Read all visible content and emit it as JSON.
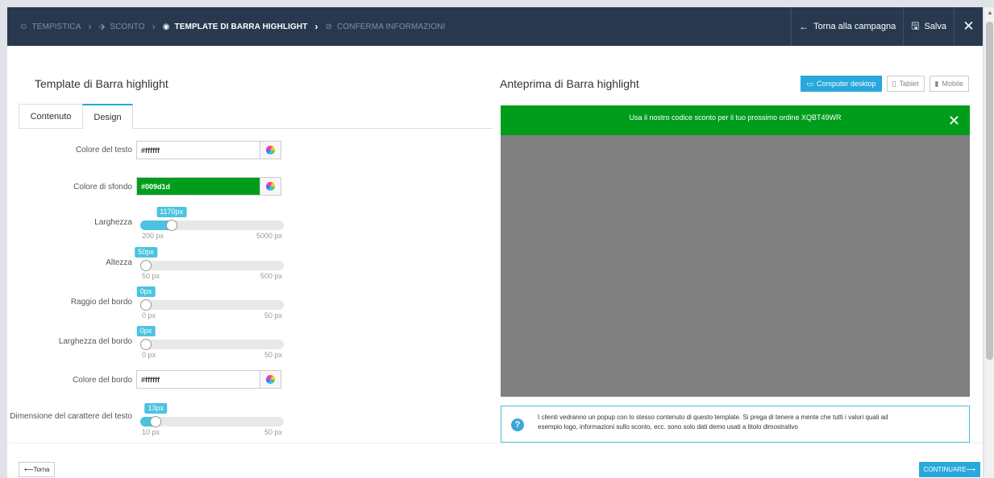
{
  "breadcrumb": [
    {
      "label": "TEMPISTICA",
      "icon": "clock-icon",
      "active": false
    },
    {
      "label": "SCONTO",
      "icon": "tag-icon",
      "active": false
    },
    {
      "label": "TEMPLATE DI BARRA HIGHLIGHT",
      "icon": "eye-icon",
      "active": true
    },
    {
      "label": "CONFERMA INFORMAZIONI",
      "icon": "check-circle-icon",
      "active": false
    }
  ],
  "topbar": {
    "back_label": "Torna alla campagna",
    "save_label": "Salva",
    "close_label": "✕"
  },
  "left": {
    "title": "Template di Barra highlight",
    "tabs": [
      "Contenuto",
      "Design"
    ],
    "active_tab": "Design",
    "fields": {
      "text_color": {
        "label": "Colore del testo",
        "value": "#ffffff"
      },
      "bg_color": {
        "label": "Colore di sfondo",
        "value": "#009d1d"
      },
      "width": {
        "label": "Larghezza",
        "value": "1170px",
        "min": "200 px",
        "max": "5000 px",
        "fraction": 0.193
      },
      "height": {
        "label": "Altezza",
        "value": "50px",
        "min": "50 px",
        "max": "500 px",
        "fraction": 0.0
      },
      "radius": {
        "label": "Raggio del bordo",
        "value": "0px",
        "min": "0 px",
        "max": "50 px",
        "fraction": 0.0
      },
      "border_width": {
        "label": "Larghezza del bordo",
        "value": "0px",
        "min": "0 px",
        "max": "50 px",
        "fraction": 0.0
      },
      "border_color": {
        "label": "Colore del bordo",
        "value": "#ffffff"
      },
      "font_size": {
        "label": "Dimensione del carattere del testo",
        "value": "13px",
        "min": "10 px",
        "max": "50 px",
        "fraction": 0.075
      }
    }
  },
  "right": {
    "title": "Anteprima di Barra highlight",
    "devices": [
      {
        "label": "Computer desktop",
        "icon": "desktop-icon",
        "active": true
      },
      {
        "label": "Tablet",
        "icon": "tablet-icon",
        "active": false
      },
      {
        "label": "Mobile",
        "icon": "mobile-icon",
        "active": false
      }
    ],
    "bar_text": "Usa il nostro codice sconto per il tuo prossimo ordine XQBT49WR",
    "bar_color": "#009d1d",
    "info_line1": "I clienti vedranno un popup con lo stesso contenuto di questo template. Si prega di tenere a mente che tutti i valori quali ad",
    "info_line2": "esempio logo, informazioni sullo sconto, ecc. sono solo dati demo usati a titolo dimostrativo"
  },
  "footer": {
    "back_label": "Torna",
    "next_label": "CONTINUARE"
  }
}
